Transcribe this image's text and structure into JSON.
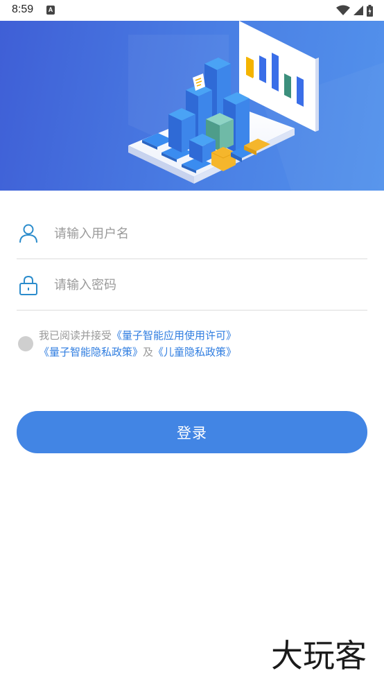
{
  "status_bar": {
    "time": "8:59",
    "notification_icon": "a-letter-icon",
    "icons": [
      "wifi-icon",
      "signal-icon",
      "battery-icon"
    ]
  },
  "banner": {
    "illustration": "isometric-data-dashboard-illustration"
  },
  "form": {
    "username_placeholder": "请输入用户名",
    "password_placeholder": "请输入密码",
    "username_icon": "user-icon",
    "password_icon": "lock-icon"
  },
  "agreement": {
    "prefix": "我已阅读并接受",
    "license_link": "《量子智能应用使用许可》",
    "privacy_link": "《量子智能隐私政策》",
    "conjunction": "及",
    "child_privacy_link": "《儿童隐私政策》",
    "checked": false
  },
  "login_button": {
    "label": "登录"
  },
  "watermark": {
    "text": "大玩客"
  },
  "colors": {
    "accent": "#4285e4",
    "link": "#2f7de0",
    "icon": "#2b8ccc",
    "banner_start": "#3f5fd6",
    "banner_end": "#5392ec"
  }
}
